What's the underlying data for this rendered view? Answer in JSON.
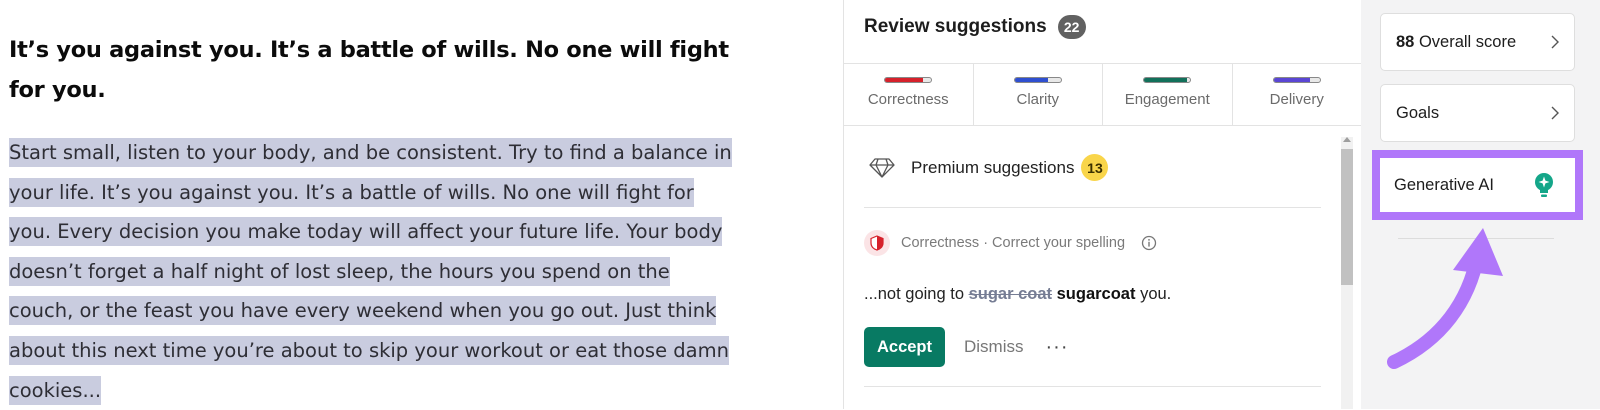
{
  "editor": {
    "heading": "It’s you against you. It’s a battle of wills. No one will fight for you.",
    "paragraph_lines": [
      "Start small, listen to your body, and be consistent. Try to find a balance in",
      "your life. It’s you against you. It’s a battle of wills. No one will fight for",
      "you. Every decision you make today will affect your future life. Your body",
      "doesn’t forget a half night of lost sleep, the hours you spend on the",
      "couch, or the feast you have every weekend when you go out. Just think",
      "about this next time you’re about to skip your workout or eat those damn",
      "cookies..."
    ]
  },
  "panel": {
    "title": "Review suggestions",
    "count": "22",
    "tabs": [
      {
        "label": "Correctness",
        "color": "#d6212b",
        "progress": 0.82
      },
      {
        "label": "Clarity",
        "color": "#2f4fd0",
        "progress": 0.72
      },
      {
        "label": "Engagement",
        "color": "#12705a",
        "progress": 0.92
      },
      {
        "label": "Delivery",
        "color": "#5a46d4",
        "progress": 0.78
      }
    ],
    "premium": {
      "label": "Premium suggestions",
      "count": "13",
      "icon": "diamond-icon"
    },
    "suggestion": {
      "category": "Correctness · Correct your spelling",
      "prefix": "...not going to ",
      "strike": "sugar coat",
      "replacement": "sugarcoat",
      "suffix": " you.",
      "accept_label": "Accept",
      "dismiss_label": "Dismiss",
      "more_label": "···"
    }
  },
  "sidebar": {
    "score_value": "88",
    "score_label": "Overall score",
    "goals_label": "Goals",
    "generative_label": "Generative AI",
    "highlight_color": "#b077fa",
    "icons": {
      "bulb": "lightbulb-sparkle-icon",
      "chevron": "chevron-right-icon"
    }
  }
}
